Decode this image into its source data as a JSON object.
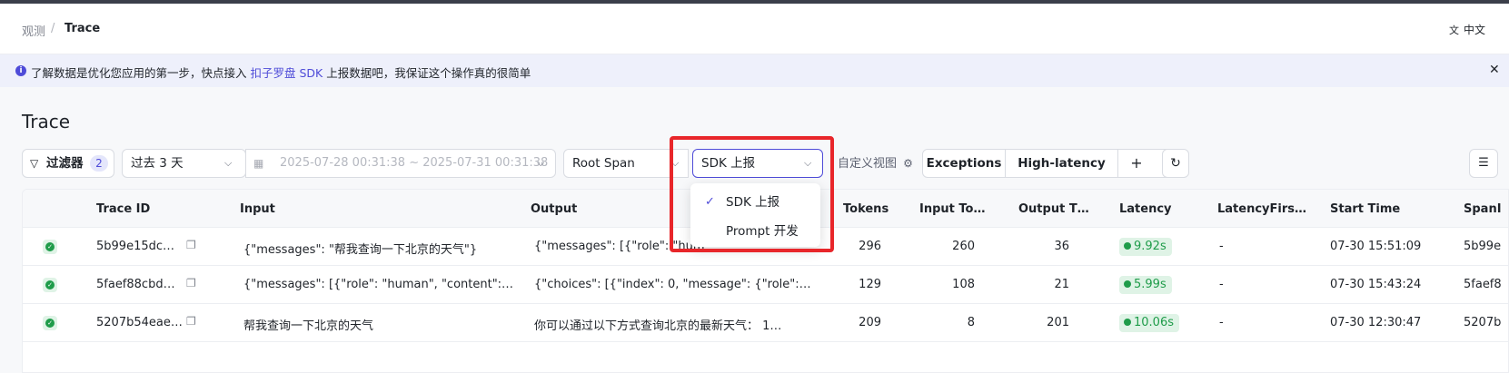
{
  "breadcrumb": {
    "parent": "观测",
    "separator": "/",
    "current": "Trace"
  },
  "language": {
    "icon": "translate-icon",
    "label": "中文"
  },
  "banner": {
    "text_before": "了解数据是优化您应用的第一步，快点接入 ",
    "link": "扣子罗盘 SDK",
    "text_after": " 上报数据吧，我保证这个操作真的很简单"
  },
  "page_title": "Trace",
  "toolbar": {
    "filter_label": "过滤器",
    "filter_count": "2",
    "time_range": "过去 3 天",
    "date_range": "2025-07-28 00:31:38 ~ 2025-07-31 00:31:38",
    "span_type": "Root Span",
    "report_source": "SDK 上报",
    "custom_view": "自定义视图",
    "views": [
      "Exceptions",
      "High-latency"
    ],
    "add_label": "+"
  },
  "dropdown": {
    "options": [
      {
        "label": "SDK 上报",
        "selected": true
      },
      {
        "label": "Prompt 开发",
        "selected": false
      }
    ]
  },
  "table": {
    "columns": [
      "Trace ID",
      "Input",
      "Output",
      "Tokens",
      "Input To…",
      "Output T…",
      "Latency",
      "LatencyFirs…",
      "Start Time",
      "SpanI"
    ],
    "rows": [
      {
        "trace_id": "5b99e15dc…",
        "input": "{\"messages\": \"帮我查询一下北京的天气\"}",
        "output": "{\"messages\": [{\"role\": \"hum",
        "tokens": "296",
        "input_tokens": "260",
        "output_tokens": "36",
        "latency": "9.92s",
        "latency_first": "-",
        "start_time": "07-30 15:51:09",
        "span_id": "5b99e"
      },
      {
        "trace_id": "5faef88cbd…",
        "input": "{\"messages\": [{\"role\": \"human\", \"content\":…",
        "output": "{\"choices\": [{\"index\": 0, \"message\": {\"role\":…",
        "tokens": "129",
        "input_tokens": "108",
        "output_tokens": "21",
        "latency": "5.99s",
        "latency_first": "-",
        "start_time": "07-30 15:43:24",
        "span_id": "5faef8"
      },
      {
        "trace_id": "5207b54eae…",
        "input": "帮我查询一下北京的天气",
        "output": "你可以通过以下方式查询北京的最新天气：  1…",
        "tokens": "209",
        "input_tokens": "8",
        "output_tokens": "201",
        "latency": "10.06s",
        "latency_first": "-",
        "start_time": "07-30 12:30:47",
        "span_id": "5207b"
      }
    ]
  },
  "colors": {
    "accent": "#4e4bd8",
    "success": "#1f9c4a",
    "highlight": "#e8262a"
  }
}
